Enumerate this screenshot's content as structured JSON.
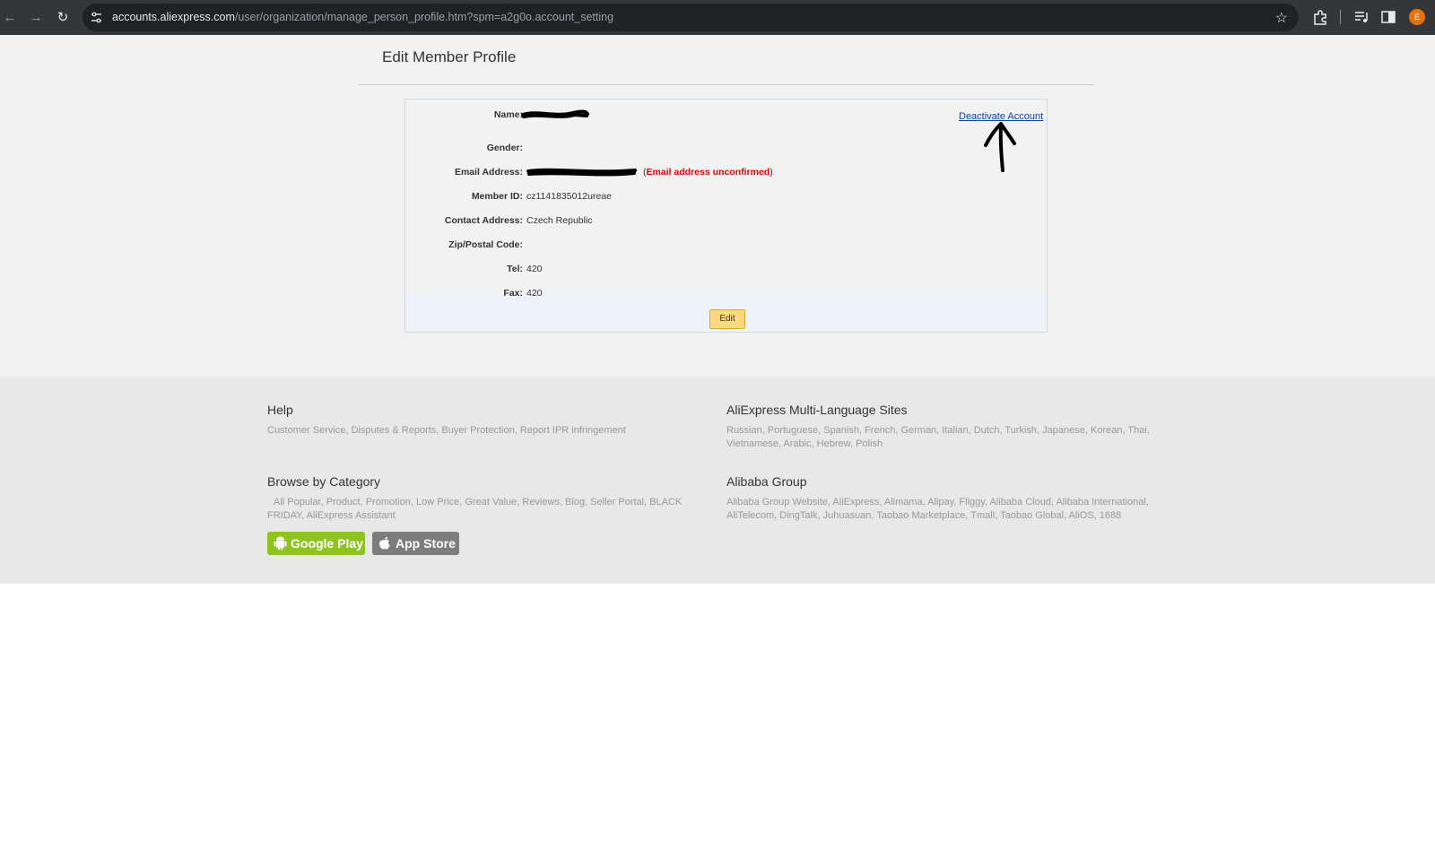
{
  "browser": {
    "url_host": "accounts.aliexpress.com",
    "url_path": "/user/organization/manage_person_profile.htm?spm=a2g0o.account_setting",
    "profile_initial": "E"
  },
  "page": {
    "title": "Edit Member Profile",
    "deactivate_label": "Deactivate Account",
    "edit_label": "Edit",
    "fields": {
      "name_label": "Name:",
      "gender_label": "Gender:",
      "email_label": "Email Address:",
      "email_warning": "Email address unconfirmed",
      "member_id_label": "Member ID:",
      "member_id_value": "cz1141835012ureae",
      "contact_label": "Contact Address:",
      "contact_value": "Czech Republic",
      "zip_label": "Zip/Postal Code:",
      "tel_label": "Tel:",
      "tel_value": "420",
      "fax_label": "Fax:",
      "fax_value": "420"
    }
  },
  "footer": {
    "help_title": "Help",
    "help_links": "Customer Service, Disputes & Reports, Buyer Protection, Report IPR infringement",
    "lang_title": "AliExpress Multi-Language Sites",
    "lang_links": "Russian, Portuguese, Spanish, French, German, Italian, Dutch, Turkish, Japanese, Korean, Thai, Vietnamese, Arabic, Hebrew, Polish",
    "browse_title": "Browse by Category",
    "browse_links": "All Popular, Product, Promotion, Low Price, Great Value, Reviews, Blog, Seller Portal, BLACK FRIDAY, AliExpress Assistant",
    "alibaba_title": "Alibaba Group",
    "alibaba_links": "Alibaba Group Website, AliExpress, Alimama, Alipay, Fliggy, Alibaba Cloud, Alibaba International, AliTelecom, DingTalk, Juhuasuan, Taobao Marketplace, Tmall, Taobao Global, AliOS, 1688",
    "google_play": "Google Play",
    "app_store": "App Store"
  },
  "colors": {
    "link": "#0c3fb4",
    "warning": "#e00000",
    "edit_button": "#fcd980",
    "google_play": "#8fc31f",
    "app_store": "#7d7d7d"
  },
  "icons": [
    "back-arrow-icon",
    "forward-arrow-icon",
    "reload-icon",
    "site-settings-icon",
    "star-icon",
    "extensions-icon",
    "media-icon",
    "side-panel-icon",
    "android-icon",
    "apple-icon"
  ]
}
